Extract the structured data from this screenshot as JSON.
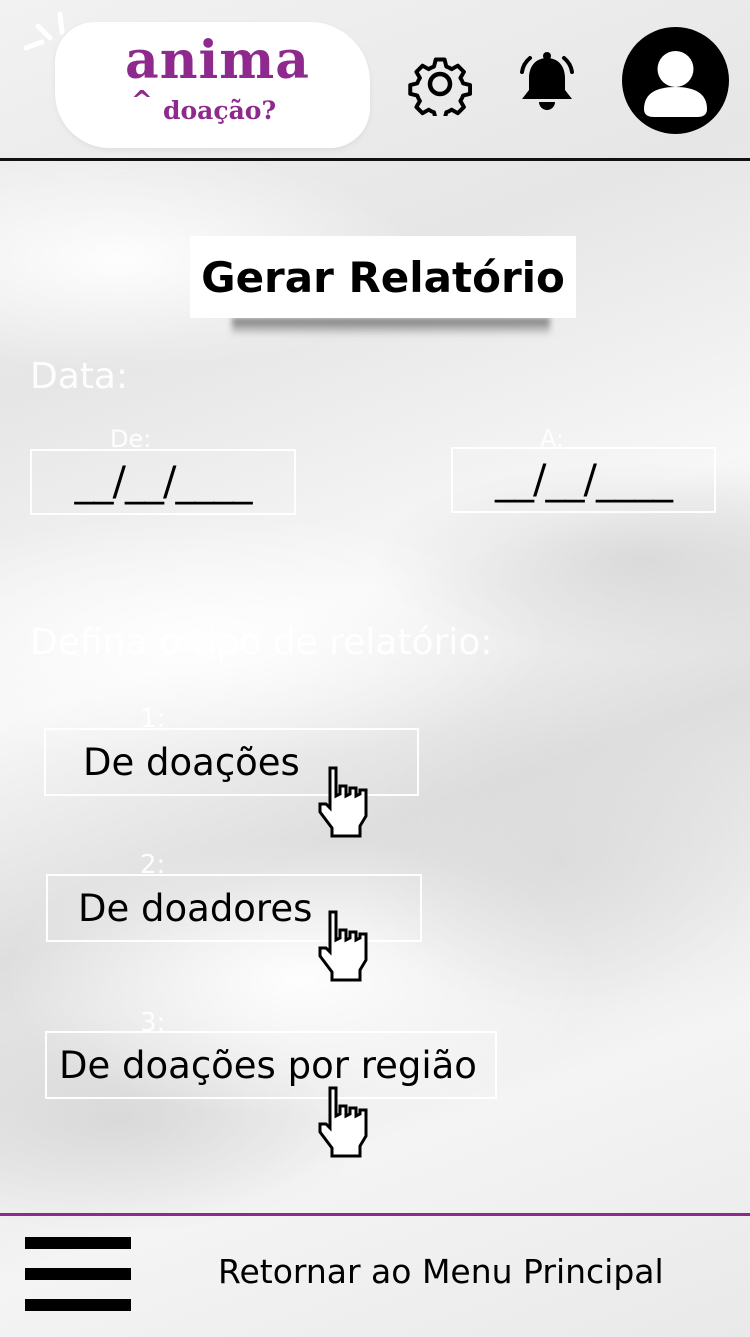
{
  "logo": {
    "brand": "anima",
    "accent": "^",
    "tagline": "doação?"
  },
  "header": {
    "icons": [
      "settings-gear-icon",
      "notification-bell-icon",
      "user-avatar-icon"
    ]
  },
  "main": {
    "title": "Gerar Relatório",
    "date_section_label": "Data:",
    "from_label": "De:",
    "to_label": "A:",
    "from_value": "__/__/____",
    "to_value": "__/__/____",
    "type_section_label": "Defina o tipo de relatório:",
    "options": [
      {
        "number": "1:",
        "label": "De doações"
      },
      {
        "number": "2:",
        "label": "De doadores"
      },
      {
        "number": "3:",
        "label": "De doações por região"
      }
    ]
  },
  "footer": {
    "menu_icon": "hamburger-menu-icon",
    "back_link": "Retornar ao Menu Principal"
  },
  "colors": {
    "brand": "#8e2a8e",
    "text": "#000000",
    "ghost": "#ffffff"
  }
}
